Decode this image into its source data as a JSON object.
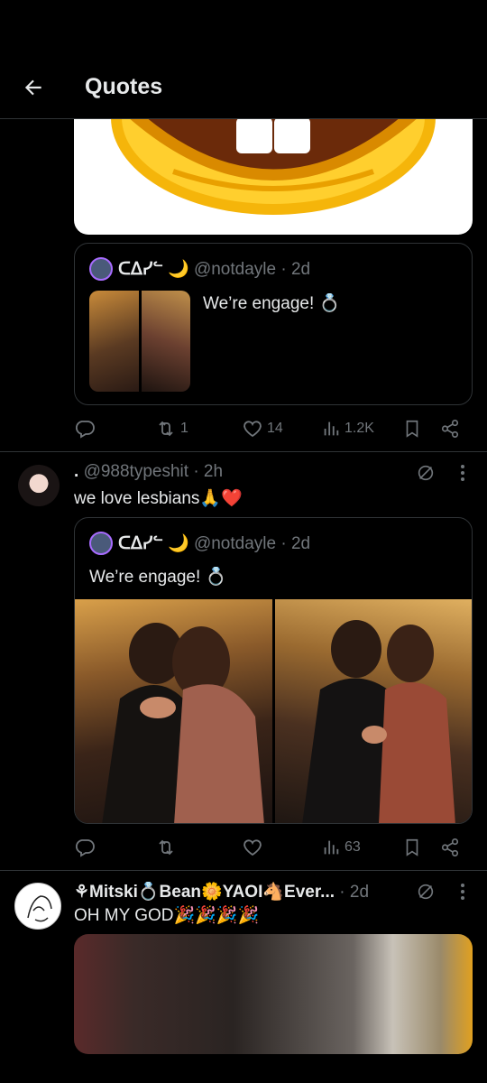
{
  "header": {
    "title": "Quotes"
  },
  "post1": {
    "quote": {
      "name": "ᑕᐃᓯᓪ 🌙",
      "handle": "@notdayle",
      "time": "· 2d",
      "text": "We’re engage! 💍"
    },
    "actions": {
      "retweets": "1",
      "likes": "14",
      "views": "1.2K"
    }
  },
  "post2": {
    "name": ".",
    "handle": "@988typeshit",
    "time": "· 2h",
    "text": "we love lesbians🙏❤️",
    "quote": {
      "name": "ᑕᐃᓯᓪ 🌙",
      "handle": "@notdayle",
      "time": "· 2d",
      "text": "We’re engage! 💍"
    },
    "actions": {
      "replies": "",
      "retweets": "",
      "likes": "",
      "views": "63"
    }
  },
  "post3": {
    "name": "⚘Mitski💍Bean🌼YAOI🐴Ever...",
    "time": "· 2d",
    "text": "OH MY GOD🎉🎉🎉🎉"
  },
  "colors": {
    "background": "#000000",
    "text": "#e7e9ea",
    "muted": "#71767b",
    "border": "#2f3336",
    "heart": "#f91880",
    "emoji_yellow": "#f5b50a"
  },
  "icons": [
    "back-arrow-icon",
    "reply-icon",
    "retweet-icon",
    "like-icon",
    "views-icon",
    "bookmark-icon",
    "share-icon",
    "grok-icon",
    "more-icon"
  ]
}
